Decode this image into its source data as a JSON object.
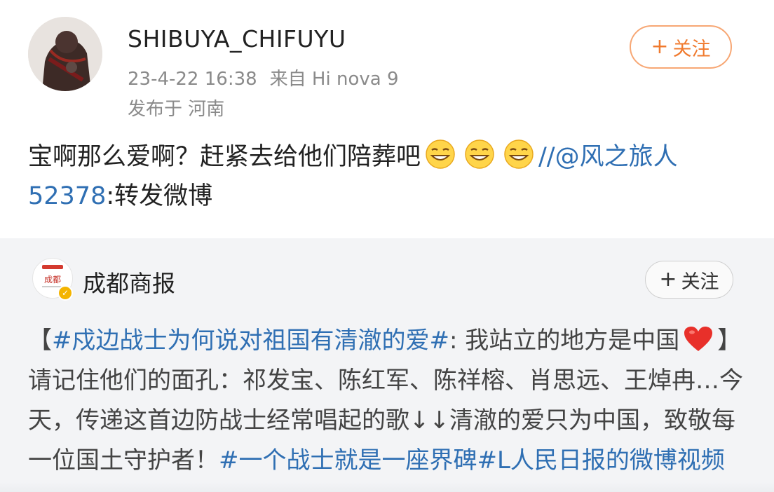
{
  "post": {
    "username": "SHIBUYA_CHIFUYU",
    "time": "23-4-22 16:38",
    "source": "来自 Hi nova 9",
    "location": "发布于 河南",
    "follow_label": "关注",
    "follow_plus": "+",
    "text_part1": "宝啊那么爱啊？赶紧去给他们陪葬吧",
    "repost_mention": "//@风之旅人 52378",
    "text_tail": ":转发微博"
  },
  "repost": {
    "name": "成都商报",
    "follow_label": "关注",
    "follow_plus": "+",
    "bracket_open": "【",
    "hashtag": "#戍边战士为何说对祖国有清澈的爱#",
    "text_a": ": 我站立的地方是中国",
    "text_b": "】请记住他们的面孔：祁发宝、陈红军、陈祥榕、肖思远、王焯冉…今天，传递这首边防战士经常唱起的歌↓↓清澈的爱只为中国，致敬每一位国土守护者！",
    "hashtag2": "#一个战士就是一座界碑#",
    "video_link": "L人民日报的微博视频"
  },
  "colors": {
    "accent_orange": "#f07a2e",
    "link_blue": "#2f6fb3"
  },
  "icons": [
    "avatar",
    "grinning-emoji",
    "heart-emoji",
    "verified-badge"
  ]
}
